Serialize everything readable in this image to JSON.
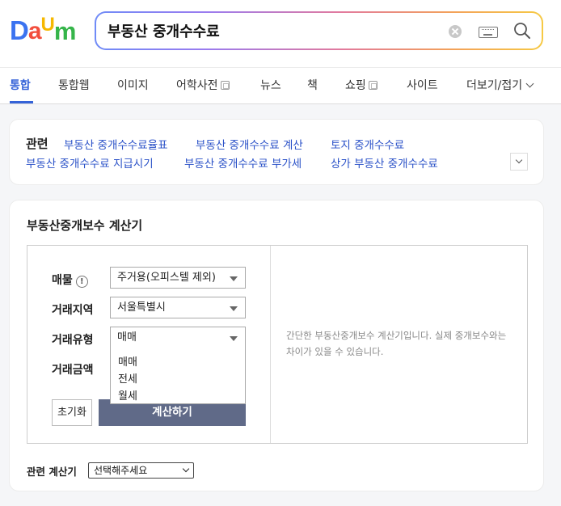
{
  "brand": {
    "letters": [
      {
        "char": "D",
        "color": "#3b73f0"
      },
      {
        "char": "a",
        "color": "#f24e3d"
      },
      {
        "char": "U",
        "color": "#f6b800"
      },
      {
        "char": "m",
        "color": "#36b54a"
      }
    ]
  },
  "search": {
    "value": "부동산 중개수수료",
    "icons": [
      "clear-icon",
      "keyboard-icon",
      "search-icon"
    ]
  },
  "tabs": [
    {
      "label": "통합",
      "active": true
    },
    {
      "label": "통합웹"
    },
    {
      "label": "이미지"
    },
    {
      "label": "어학사전",
      "external": true
    },
    {
      "label": "뉴스"
    },
    {
      "label": "책"
    },
    {
      "label": "쇼핑",
      "external": true
    },
    {
      "label": "사이트"
    },
    {
      "label": "더보기/접기"
    }
  ],
  "related": {
    "title": "관련",
    "links": [
      "부동산 중개수수료율표",
      "부동산 중개수수료 계산",
      "토지 중개수수료",
      "부동산 중개수수료 지급시기",
      "부동산 중개수수료 부가세",
      "상가 부동산 중개수수료"
    ]
  },
  "calculator": {
    "title": "부동산중개보수 계산기",
    "fields": {
      "property": {
        "label": "매물",
        "value": "주거용(오피스텔 제외)"
      },
      "region": {
        "label": "거래지역",
        "value": "서울특별시"
      },
      "type": {
        "label": "거래유형",
        "value": "매매",
        "options": [
          "매매",
          "전세",
          "월세"
        ]
      },
      "amount": {
        "label": "거래금액"
      }
    },
    "reset_label": "초기화",
    "calc_label": "계산하기",
    "description": "간단한 부동산중개보수 계산기입니다. 실제 중개보수와는 차이가 있을 수 있습니다.",
    "button_color": "#606a88"
  },
  "related_calc": {
    "label": "관련 계산기",
    "value": "선택해주세요"
  },
  "colors": {
    "accent": "#3563d8",
    "link": "#2b52c8"
  }
}
